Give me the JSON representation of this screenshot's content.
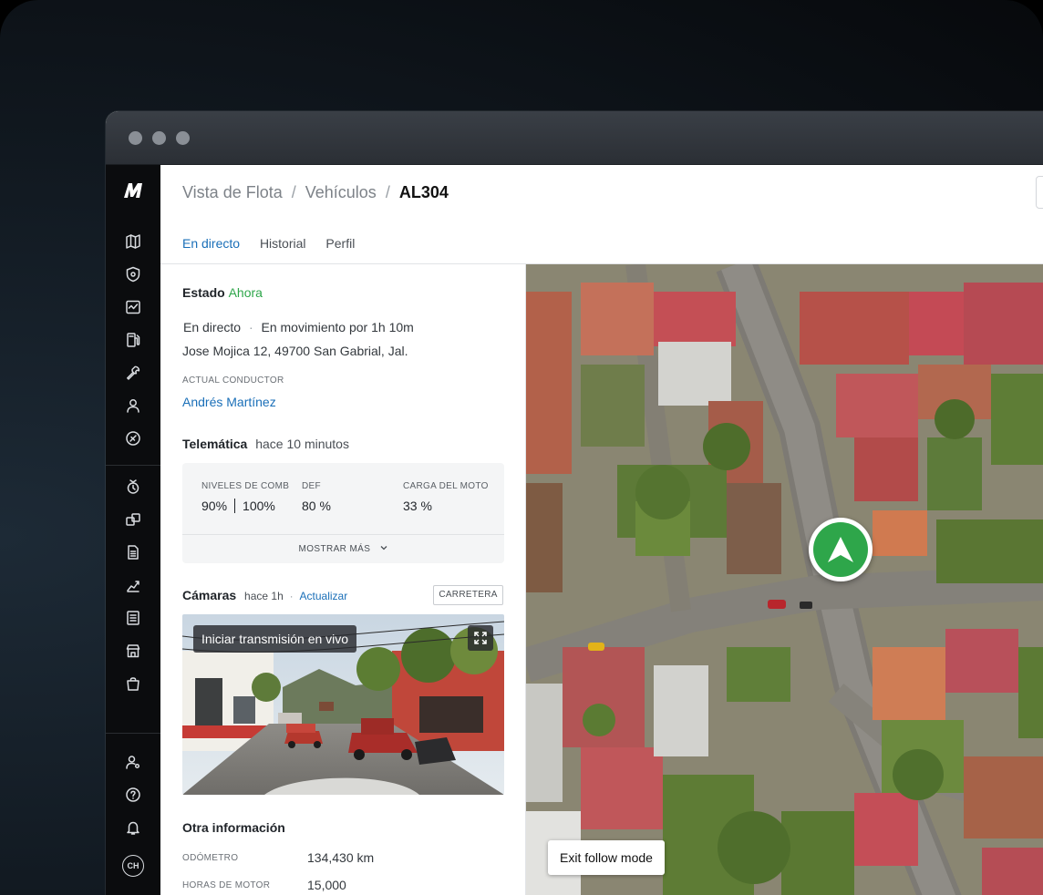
{
  "breadcrumb": {
    "items": [
      "Vista de Flota",
      "Vehículos"
    ],
    "separator": "/",
    "current": "AL304"
  },
  "tabs": [
    {
      "label": "En directo",
      "active": true
    },
    {
      "label": "Historial",
      "active": false
    },
    {
      "label": "Perfil",
      "active": false
    }
  ],
  "estado": {
    "title": "Estado",
    "time": "Ahora",
    "status_mode": "En directo",
    "status_dot": "·",
    "status_detail": "En movimiento por 1h 10m",
    "address": "Jose Mojica 12, 49700 San Gabrial, Jal.",
    "driver_label": "ACTUAL CONDUCTOR",
    "driver_name": "Andrés Martínez"
  },
  "telematica": {
    "title": "Telemática",
    "time": "hace 10 minutos",
    "fuel_label": "NIVELES DE COMB",
    "fuel_value_1": "90%",
    "fuel_value_2": "100%",
    "def_label": "DEF",
    "def_value": "80 %",
    "engine_label": "CARGA DEL MOTO",
    "engine_value": "33 %",
    "show_more": "MOSTRAR MÁS"
  },
  "camaras": {
    "title": "Cámaras",
    "time": "hace 1h",
    "dot": "·",
    "refresh": "Actualizar",
    "view_button": "CARRETERA",
    "live_button": "Iniciar transmisión en vivo"
  },
  "otra": {
    "title": "Otra información",
    "odometer_label": "ODÓMETRO",
    "odometer_value": "134,430 km",
    "engine_hours_label": "HORAS DE MOTOR",
    "engine_hours_value": "15,000"
  },
  "map": {
    "exit_follow": "Exit follow mode"
  },
  "user": {
    "initials": "CH"
  },
  "sidebar_icons": [
    "map-icon",
    "shield-icon",
    "dashboard-icon",
    "fuel-icon",
    "wrench-icon",
    "driver-icon",
    "tag-icon",
    "safety-icon",
    "routes-icon",
    "document-icon",
    "reports-icon",
    "list-icon",
    "store-icon",
    "bag-icon",
    "user-settings-icon",
    "help-icon",
    "bell-icon"
  ],
  "colors": {
    "accent_blue": "#1a6fb8",
    "status_green": "#2ea64a",
    "sidebar_bg": "#0b0c0e"
  }
}
